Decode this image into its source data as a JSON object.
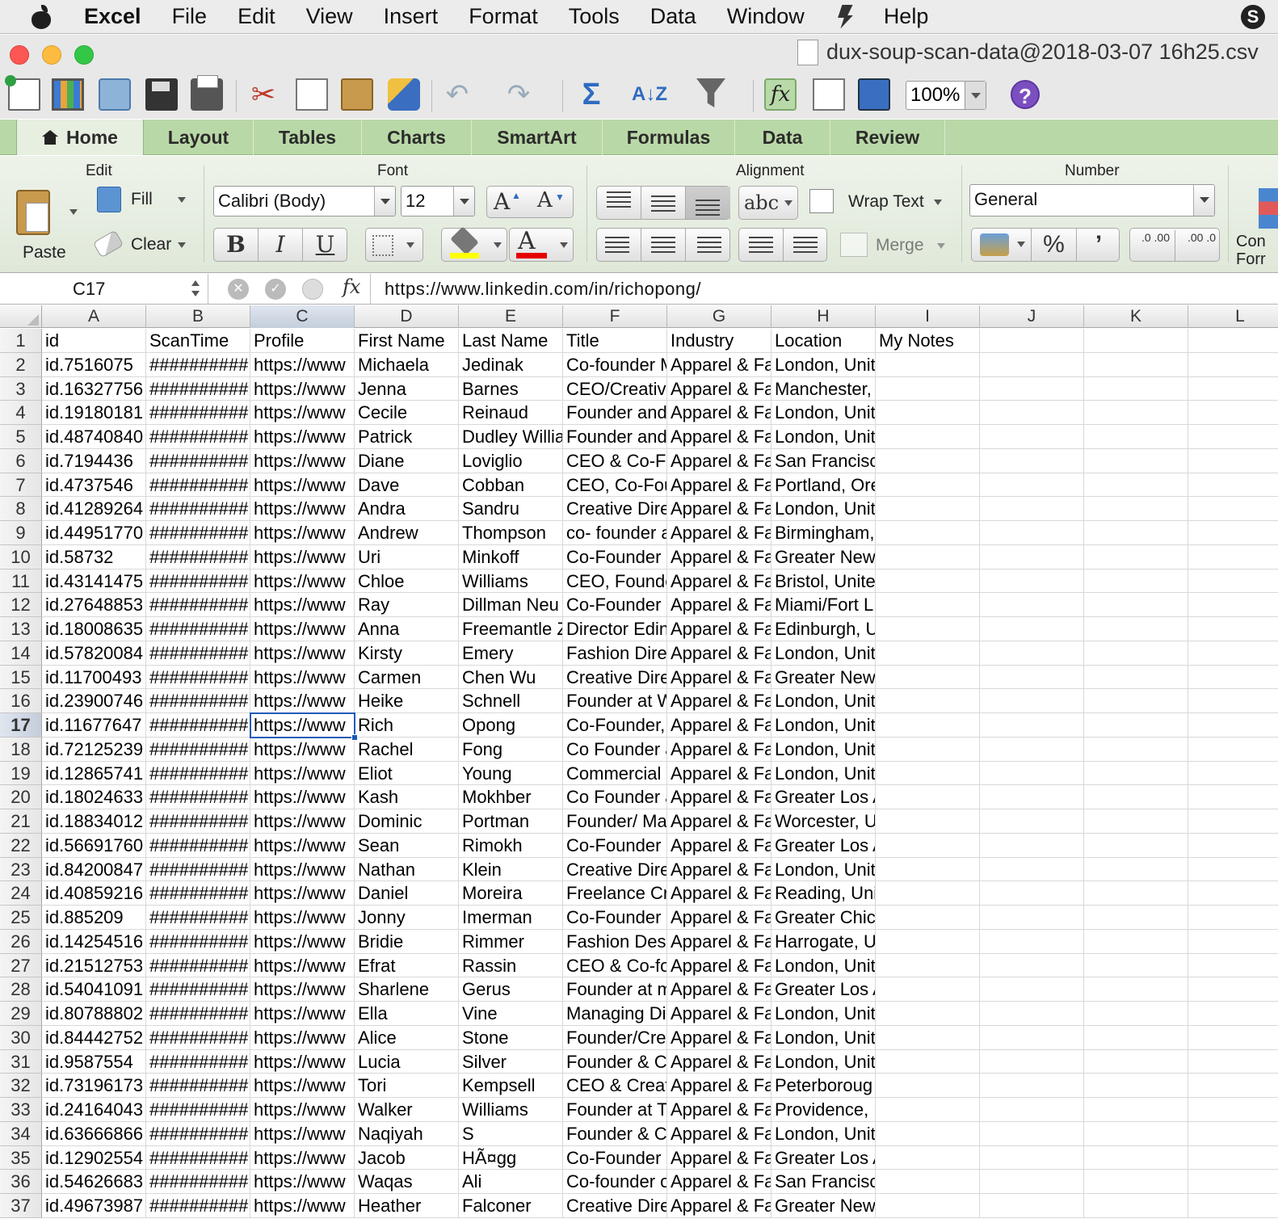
{
  "menubar": {
    "app": "Excel",
    "items": [
      "File",
      "Edit",
      "View",
      "Insert",
      "Format",
      "Tools",
      "Data",
      "Window",
      "Help"
    ]
  },
  "window": {
    "title": "dux-soup-scan-data@2018-03-07 16h25.csv"
  },
  "toolbar": {
    "zoom": "100%"
  },
  "ribbon": {
    "tabs": [
      "Home",
      "Layout",
      "Tables",
      "Charts",
      "SmartArt",
      "Formulas",
      "Data",
      "Review"
    ],
    "active_tab": "Home",
    "groups": {
      "edit": "Edit",
      "font": "Font",
      "alignment": "Alignment",
      "number": "Number"
    },
    "edit": {
      "paste": "Paste",
      "fill": "Fill",
      "clear": "Clear"
    },
    "font": {
      "name": "Calibri (Body)",
      "size": "12",
      "bold": "B",
      "italic": "I",
      "underline": "U",
      "grow": "A",
      "shrink": "A",
      "font_color": "A"
    },
    "alignment": {
      "abc": "abc",
      "wrap_text": "Wrap Text",
      "merge": "Merge"
    },
    "number": {
      "format": "General",
      "percent": "%",
      "comma": "’",
      "inc_decimal": ".0 .00",
      "dec_decimal": ".00 .0"
    },
    "cond_format": [
      "Con",
      "Forr"
    ]
  },
  "formula_bar": {
    "name_box": "C17",
    "fx": "fx",
    "content": "https://www.linkedin.com/in/richopong/"
  },
  "sheet": {
    "columns": [
      "A",
      "B",
      "C",
      "D",
      "E",
      "F",
      "G",
      "H",
      "I",
      "J",
      "K",
      "L"
    ],
    "selected_cell": "C17",
    "rows": [
      {
        "n": "1",
        "cells": [
          "id",
          "ScanTime",
          "Profile",
          "First Name",
          "Last Name",
          "Title",
          "Industry",
          "Location",
          "My Notes"
        ]
      },
      {
        "n": "2",
        "cells": [
          "id.7516075",
          "##########",
          "https://www",
          "Michaela",
          "Jedinak",
          "Co-founder M",
          "Apparel & Fa",
          "London, Unit",
          ""
        ]
      },
      {
        "n": "3",
        "cells": [
          "id.16327756",
          "##########",
          "https://www",
          "Jenna",
          "Barnes",
          "CEO/Creative",
          "Apparel & Fa",
          "Manchester,",
          ""
        ]
      },
      {
        "n": "4",
        "cells": [
          "id.19180181",
          "##########",
          "https://www",
          "Cecile",
          "Reinaud",
          "Founder and",
          "Apparel & Fa",
          "London, Unit",
          ""
        ]
      },
      {
        "n": "5",
        "cells": [
          "id.48740840",
          "##########",
          "https://www",
          "Patrick",
          "Dudley Willia",
          "Founder and",
          "Apparel & Fa",
          "London, Unit",
          ""
        ]
      },
      {
        "n": "6",
        "cells": [
          "id.7194436",
          "##########",
          "https://www",
          "Diane",
          "Loviglio",
          "CEO & Co-Fo",
          "Apparel & Fa",
          "San Francisco",
          ""
        ]
      },
      {
        "n": "7",
        "cells": [
          "id.4737546",
          "##########",
          "https://www",
          "Dave",
          "Cobban",
          "CEO, Co-Fou",
          "Apparel & Fa",
          "Portland, Ore",
          ""
        ]
      },
      {
        "n": "8",
        "cells": [
          "id.41289264",
          "##########",
          "https://www",
          "Andra",
          "Sandru",
          "Creative Dire",
          "Apparel & Fa",
          "London, Unit",
          ""
        ]
      },
      {
        "n": "9",
        "cells": [
          "id.44951770",
          "##########",
          "https://www",
          "Andrew",
          "Thompson",
          "co- founder a",
          "Apparel & Fa",
          "Birmingham,",
          ""
        ]
      },
      {
        "n": "10",
        "cells": [
          "id.58732",
          "##########",
          "https://www",
          "Uri",
          "Minkoff",
          "Co-Founder a",
          "Apparel & Fa",
          "Greater New",
          ""
        ]
      },
      {
        "n": "11",
        "cells": [
          "id.43141475",
          "##########",
          "https://www",
          "Chloe",
          "Williams",
          "CEO, Founde",
          "Apparel & Fa",
          "Bristol, Unite",
          ""
        ]
      },
      {
        "n": "12",
        "cells": [
          "id.27648853",
          "##########",
          "https://www",
          "Ray",
          "Dillman Neu",
          "Co-Founder I",
          "Apparel & Fa",
          "Miami/Fort L",
          ""
        ]
      },
      {
        "n": "13",
        "cells": [
          "id.18008635",
          "##########",
          "https://www",
          "Anna",
          "Freemantle Z",
          "Director Edin",
          "Apparel & Fa",
          "Edinburgh, U",
          ""
        ]
      },
      {
        "n": "14",
        "cells": [
          "id.57820084",
          "##########",
          "https://www",
          "Kirsty",
          "Emery",
          "Fashion Dire",
          "Apparel & Fa",
          "London, Unit",
          ""
        ]
      },
      {
        "n": "15",
        "cells": [
          "id.11700493",
          "##########",
          "https://www",
          "Carmen",
          "Chen Wu",
          "Creative Dire",
          "Apparel & Fa",
          "Greater New",
          ""
        ]
      },
      {
        "n": "16",
        "cells": [
          "id.23900746",
          "##########",
          "https://www",
          "Heike",
          "Schnell",
          "Founder at W",
          "Apparel & Fa",
          "London, Unit",
          ""
        ]
      },
      {
        "n": "17",
        "cells": [
          "id.11677647",
          "##########",
          "https://www",
          "Rich",
          "Opong",
          "Co-Founder,",
          "Apparel & Fa",
          "London, Unit",
          ""
        ]
      },
      {
        "n": "18",
        "cells": [
          "id.72125239",
          "##########",
          "https://www",
          "Rachel",
          "Fong",
          "Co Founder a",
          "Apparel & Fa",
          "London, Unit",
          ""
        ]
      },
      {
        "n": "19",
        "cells": [
          "id.12865741",
          "##########",
          "https://www",
          "Eliot",
          "Young",
          "Commercial ,",
          "Apparel & Fa",
          "London, Unit",
          ""
        ]
      },
      {
        "n": "20",
        "cells": [
          "id.18024633",
          "##########",
          "https://www",
          "Kash",
          "Mokhber",
          "Co Founder a",
          "Apparel & Fa",
          "Greater Los A",
          ""
        ]
      },
      {
        "n": "21",
        "cells": [
          "id.18834012",
          "##########",
          "https://www",
          "Dominic",
          "Portman",
          "Founder/ Ma",
          "Apparel & Fa",
          "Worcester, U",
          ""
        ]
      },
      {
        "n": "22",
        "cells": [
          "id.56691760",
          "##########",
          "https://www",
          "Sean",
          "Rimokh",
          "Co-Founder (",
          "Apparel & Fa",
          "Greater Los A",
          ""
        ]
      },
      {
        "n": "23",
        "cells": [
          "id.84200847",
          "##########",
          "https://www",
          "Nathan",
          "Klein",
          "Creative Dire",
          "Apparel & Fa",
          "London, Unit",
          ""
        ]
      },
      {
        "n": "24",
        "cells": [
          "id.40859216",
          "##########",
          "https://www",
          "Daniel",
          "Moreira",
          "Freelance Cr",
          "Apparel & Fa",
          "Reading, Uni",
          ""
        ]
      },
      {
        "n": "25",
        "cells": [
          "id.885209",
          "##########",
          "https://www",
          "Jonny",
          "Imerman",
          "Co-Founder a",
          "Apparel & Fa",
          "Greater Chic",
          ""
        ]
      },
      {
        "n": "26",
        "cells": [
          "id.14254516",
          "##########",
          "https://www",
          "Bridie",
          "Rimmer",
          "Fashion Desi",
          "Apparel & Fa",
          "Harrogate, U",
          ""
        ]
      },
      {
        "n": "27",
        "cells": [
          "id.21512753",
          "##########",
          "https://www",
          "Efrat",
          "Rassin",
          "CEO & Co-fou",
          "Apparel & Fa",
          "London, Unit",
          ""
        ]
      },
      {
        "n": "28",
        "cells": [
          "id.54041091",
          "##########",
          "https://www",
          "Sharlene",
          "Gerus",
          "Founder at m",
          "Apparel & Fa",
          "Greater Los A",
          ""
        ]
      },
      {
        "n": "29",
        "cells": [
          "id.80788802",
          "##########",
          "https://www",
          "Ella",
          "Vine",
          "Managing Di",
          "Apparel & Fa",
          "London, Unit",
          ""
        ]
      },
      {
        "n": "30",
        "cells": [
          "id.84442752",
          "##########",
          "https://www",
          "Alice",
          "Stone",
          "Founder/Cre",
          "Apparel & Fa",
          "London, Unit",
          ""
        ]
      },
      {
        "n": "31",
        "cells": [
          "id.9587554",
          "##########",
          "https://www",
          "Lucia",
          "Silver",
          "Founder & C",
          "Apparel & Fa",
          "London, Unit",
          ""
        ]
      },
      {
        "n": "32",
        "cells": [
          "id.73196173",
          "##########",
          "https://www",
          "Tori",
          "Kempsell",
          "CEO & Creati",
          "Apparel & Fa",
          "Peterboroug",
          ""
        ]
      },
      {
        "n": "33",
        "cells": [
          "id.24164043",
          "##########",
          "https://www",
          "Walker",
          "Williams",
          "Founder at T",
          "Apparel & Fa",
          "Providence, I",
          ""
        ]
      },
      {
        "n": "34",
        "cells": [
          "id.63666866",
          "##########",
          "https://www",
          "Naqiyah",
          "S",
          "Founder & C",
          "Apparel & Fa",
          "London, Unit",
          ""
        ]
      },
      {
        "n": "35",
        "cells": [
          "id.12902554",
          "##########",
          "https://www",
          "Jacob",
          "HÃ¤gg",
          "Co-Founder I",
          "Apparel & Fa",
          "Greater Los A",
          ""
        ]
      },
      {
        "n": "36",
        "cells": [
          "id.54626683",
          "##########",
          "https://www",
          "Waqas",
          "Ali",
          "Co-founder o",
          "Apparel & Fa",
          "San Francisco",
          ""
        ]
      },
      {
        "n": "37",
        "cells": [
          "id.49673987",
          "##########",
          "https://www",
          "Heather",
          "Falconer",
          "Creative Dire",
          "Apparel & Fa",
          "Greater New",
          ""
        ]
      }
    ]
  }
}
